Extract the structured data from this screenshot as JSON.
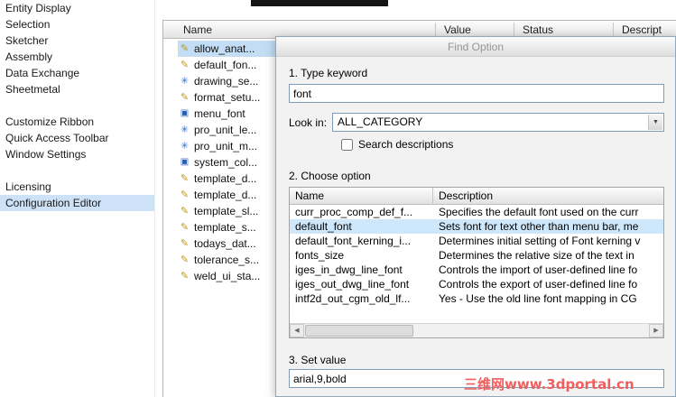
{
  "sidebar": {
    "items": [
      {
        "label": "Entity Display",
        "selected": false
      },
      {
        "label": "Selection",
        "selected": false
      },
      {
        "label": "Sketcher",
        "selected": false
      },
      {
        "label": "Assembly",
        "selected": false
      },
      {
        "label": "Data Exchange",
        "selected": false
      },
      {
        "label": "Sheetmetal",
        "selected": false
      },
      {
        "label": "Customize Ribbon",
        "selected": false
      },
      {
        "label": "Quick Access Toolbar",
        "selected": false
      },
      {
        "label": "Window Settings",
        "selected": false
      },
      {
        "label": "Licensing",
        "selected": false
      },
      {
        "label": "Configuration Editor",
        "selected": true
      }
    ]
  },
  "main_table": {
    "columns": [
      "Name",
      "Value",
      "Status",
      "Descript"
    ],
    "rows": [
      {
        "name": "allow_anat...",
        "icon": "pencil",
        "selected": true
      },
      {
        "name": "default_fon...",
        "icon": "pencil",
        "selected": false
      },
      {
        "name": "drawing_se...",
        "icon": "asterisk",
        "selected": false
      },
      {
        "name": "format_setu...",
        "icon": "pencil",
        "selected": false
      },
      {
        "name": "menu_font",
        "icon": "square",
        "selected": false
      },
      {
        "name": "pro_unit_le...",
        "icon": "asterisk",
        "selected": false
      },
      {
        "name": "pro_unit_m...",
        "icon": "asterisk",
        "selected": false
      },
      {
        "name": "system_col...",
        "icon": "square",
        "selected": false
      },
      {
        "name": "template_d...",
        "icon": "pencil",
        "selected": false
      },
      {
        "name": "template_d...",
        "icon": "pencil",
        "selected": false
      },
      {
        "name": "template_sl...",
        "icon": "pencil",
        "selected": false
      },
      {
        "name": "template_s...",
        "icon": "pencil",
        "selected": false
      },
      {
        "name": "todays_dat...",
        "icon": "pencil",
        "selected": false
      },
      {
        "name": "tolerance_s...",
        "icon": "pencil",
        "selected": false
      },
      {
        "name": "weld_ui_sta...",
        "icon": "pencil",
        "selected": false
      }
    ]
  },
  "icon_map": {
    "pencil": "✎",
    "asterisk": "✳",
    "square": "▣",
    "dropdown_arrow": "▼",
    "scroll_left": "◀",
    "scroll_right": "▶"
  },
  "dialog": {
    "title": "Find Option",
    "step1_label": "1. Type keyword",
    "keyword_value": "font",
    "look_in_label": "Look in:",
    "look_in_value": "ALL_CATEGORY",
    "search_descriptions_label": "Search descriptions",
    "step2_label": "2. Choose option",
    "results": {
      "columns": [
        "Name",
        "Description"
      ],
      "selected": "default_font",
      "rows": [
        {
          "name": "curr_proc_comp_def_f...",
          "description": "Specifies the default font used on the curr"
        },
        {
          "name": "default_font",
          "description": "Sets font for text other than menu bar, me"
        },
        {
          "name": "default_font_kerning_i...",
          "description": "Determines initial setting of Font kerning v"
        },
        {
          "name": "fonts_size",
          "description": "Determines the relative size of the text in"
        },
        {
          "name": "iges_in_dwg_line_font",
          "description": "Controls the import of user-defined line fo"
        },
        {
          "name": "iges_out_dwg_line_font",
          "description": "Controls the export of user-defined line fo"
        },
        {
          "name": "intf2d_out_cgm_old_lf...",
          "description": "Yes - Use the old line font mapping in CG"
        }
      ]
    },
    "step3_label": "3. Set value",
    "set_value": "arial,9,bold"
  },
  "watermark": "三维网www.3dportal.cn",
  "colors": {
    "selection_blue": "#cde2f6",
    "input_border": "#7f9db9",
    "watermark_red": "#f05e5e"
  }
}
